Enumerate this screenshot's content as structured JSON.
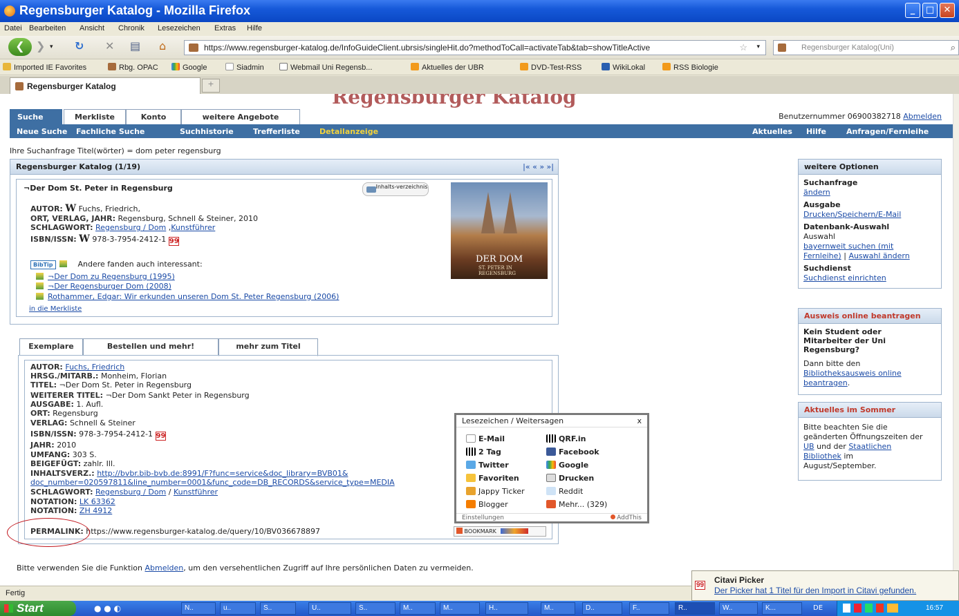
{
  "window": {
    "title": "Regensburger Katalog - Mozilla Firefox"
  },
  "menu": [
    "Datei",
    "Bearbeiten",
    "Ansicht",
    "Chronik",
    "Lesezeichen",
    "Extras",
    "Hilfe"
  ],
  "nav": {
    "url": "https://www.regensburger-katalog.de/InfoGuideClient.ubrsis/singleHit.do?methodToCall=activateTab&tab=showTitleActive",
    "search_placeholder": "Regensburger Katalog(Uni)"
  },
  "bookmarks": [
    "Imported IE Favorites",
    "Rbg. OPAC",
    "Google",
    "Siadmin",
    "Webmail Uni Regensb...",
    "Aktuelles der UBR",
    "DVD-Test-RSS",
    "WikiLokal",
    "RSS Biologie"
  ],
  "browser_tab": {
    "label": "Regensburger Katalog",
    "new_tab": "+"
  },
  "site": {
    "bg_title": "Regensburger Katalog",
    "tabs": [
      "Suche",
      "Merkliste",
      "Konto",
      "weitere Angebote"
    ],
    "user": {
      "text": "Benutzernummer 06900382718",
      "logout": "Abmelden"
    },
    "subnav": [
      "Neue Suche",
      "Fachliche Suche",
      "Suchhistorie",
      "Trefferliste",
      "Detailanzeige"
    ],
    "subnav_right": [
      "Aktuelles",
      "Hilfe",
      "Anfragen/Fernleihe"
    ],
    "query": "Ihre Suchanfrage Titel(wörter) = dom peter regensburg"
  },
  "record": {
    "header": "Regensburger Katalog (1/19)",
    "pager": "|« « » »|",
    "title": "¬Der Dom St. Peter in Regensburg",
    "toc_button": "Inhalts-verzeichnis",
    "autor_label": "AUTOR:",
    "autor_value": "Fuchs, Friedrich,",
    "ort_label": "ORT, VERLAG, JAHR:",
    "ort_value": "Regensburg, Schnell & Steiner, 2010",
    "schlag_label": "SCHLAGWORT:",
    "schlag_link1": "Regensburg / Dom",
    "schlag_link2": "Kunstführer",
    "isbn_label": "ISBN/ISSN:",
    "isbn_value": "978-3-7954-2412-1",
    "bibtip": "BibTip",
    "also_label": "Andere fanden auch interessant:",
    "also": [
      "¬Der Dom zu Regensburg (1995)",
      "¬Der Regensburger Dom (2008)",
      "Rothammer, Edgar: Wir erkunden unseren Dom St. Peter Regensburg (2006)"
    ],
    "merkliste": "in die Merkliste",
    "cover_title": "DER DOM",
    "cover_sub": "ST. PETER IN REGENSBURG"
  },
  "detail_tabs": [
    "Exemplare",
    "Bestellen und mehr!",
    "mehr zum Titel"
  ],
  "detail": {
    "autor_l": "AUTOR:",
    "autor_v": "Fuchs, Friedrich",
    "hrsg_l": "HRSG./MITARB.:",
    "hrsg_v": "Monheim, Florian",
    "titel_l": "TITEL:",
    "titel_v": "¬Der Dom St. Peter in Regensburg",
    "wt_l": "WEITERER TITEL:",
    "wt_v": "¬Der Dom Sankt Peter in Regensburg",
    "ausg_l": "AUSGABE:",
    "ausg_v": "1. Aufl.",
    "ort_l": "ORT:",
    "ort_v": "Regensburg",
    "verl_l": "VERLAG:",
    "verl_v": "Schnell & Steiner",
    "isbn_l": "ISBN/ISSN:",
    "isbn_v": "978-3-7954-2412-1",
    "jahr_l": "JAHR:",
    "jahr_v": "2010",
    "umf_l": "UMFANG:",
    "umf_v": "303 S.",
    "beig_l": "BEIGEFÜGT:",
    "beig_v": "zahlr. Ill.",
    "inh_l": "INHALTSVERZ.:",
    "inh_v1": "http://bvbr.bib-bvb.de:8991/F?func=service&doc_library=BVB01&",
    "inh_v2": "doc_number=020597811&line_number=0001&func_code=DB_RECORDS&service_type=MEDIA",
    "sw_l": "SCHLAGWORT:",
    "sw_v1": "Regensburg / Dom",
    "sw_sep": "/",
    "sw_v2": "Kunstführer",
    "not1_l": "NOTATION:",
    "not1_v": "LK 63362",
    "not2_l": "NOTATION:",
    "not2_v": "ZH 4912",
    "perm_l": "PERMALINK:",
    "perm_v": "https://www.regensburger-katalog.de/query/10/BV036678897",
    "bookmark_btn": "BOOKMARK"
  },
  "popup": {
    "title": "Lesezeichen / Weitersagen",
    "close": "x",
    "items": [
      "E-Mail",
      "QRF.in",
      "2 Tag",
      "Facebook",
      "Twitter",
      "Google",
      "Favoriten",
      "Drucken",
      "Jappy Ticker",
      "Reddit",
      "Blogger",
      "Mehr... (329)"
    ],
    "settings": "Einstellungen",
    "addthis": "AddThis"
  },
  "footer_note": {
    "before": "Bitte verwenden Sie die Funktion",
    "link": "Abmelden",
    "after": ", um den versehentlichen Zugriff auf Ihre persönlichen Daten zu vermeiden."
  },
  "side": {
    "opt_head": "weitere Optionen",
    "such_l": "Suchanfrage",
    "such_link": "ändern",
    "ausg_l": "Ausgabe",
    "ausg_link": "Drucken/Speichern/E-Mail",
    "db_l": "Datenbank-Auswahl",
    "db_v": "Auswahl",
    "db_link1a": "bayernweit suchen (mit",
    "db_link1b": "Fernleihe)",
    "db_sep": "|",
    "db_link2": "Auswahl ändern",
    "sd_l": "Suchdienst",
    "sd_link": "Suchdienst einrichten",
    "ausw_head": "Ausweis online beantragen",
    "ausw_bold": [
      "Kein Student oder",
      "Mitarbeiter der Uni",
      "Regensburg?"
    ],
    "ausw_text": "Dann bitte den",
    "ausw_link1": "Bibliotheksausweis online",
    "ausw_link2": "beantragen",
    "ausw_dot": ".",
    "akt_head": "Aktuelles im Sommer",
    "akt_l1": "Bitte beachten Sie die",
    "akt_l2": "geänderten Öffnungszeiten der",
    "akt_ub": "UB",
    "akt_und": "und der",
    "akt_staat": "Staatlichen",
    "akt_bib": "Bibliothek",
    "akt_im": "im",
    "akt_l5": "August/September."
  },
  "status": {
    "text": "Fertig"
  },
  "citavi": {
    "title": "Citavi Picker",
    "message": "Der Picker hat 1 Titel für den Import in Citavi gefunden."
  },
  "taskbar": {
    "start": "Start",
    "items": [
      "N..",
      "u..",
      "S..",
      "U..",
      "S..",
      "M..",
      "M..",
      "H..",
      "M..",
      "D..",
      "F..",
      "R..",
      "W..",
      "K..."
    ],
    "lang": "DE",
    "clock": "16:57"
  }
}
